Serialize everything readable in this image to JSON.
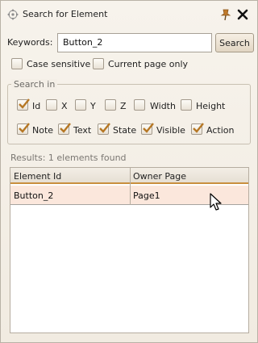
{
  "window": {
    "title": "Search for Element",
    "icons": {
      "move": "move-icon",
      "pin": "pin-icon",
      "close": "close-icon"
    }
  },
  "search": {
    "keywords_label": "Keywords:",
    "keywords_value": "Button_2",
    "button_label": "Search",
    "case_sensitive": {
      "label": "Case sensitive",
      "checked": false
    },
    "current_page_only": {
      "label": "Current page only",
      "checked": false
    }
  },
  "search_in": {
    "legend": "Search in",
    "options": [
      {
        "label": "Id",
        "checked": true
      },
      {
        "label": "X",
        "checked": false
      },
      {
        "label": "Y",
        "checked": false
      },
      {
        "label": "Z",
        "checked": false
      },
      {
        "label": "Width",
        "checked": false
      },
      {
        "label": "Height",
        "checked": false
      },
      {
        "label": "Note",
        "checked": true
      },
      {
        "label": "Text",
        "checked": true
      },
      {
        "label": "State",
        "checked": true
      },
      {
        "label": "Visible",
        "checked": true
      },
      {
        "label": "Action",
        "checked": true
      }
    ]
  },
  "results": {
    "summary": "Results: 1 elements found",
    "columns": [
      "Element Id",
      "Owner Page"
    ],
    "rows": [
      {
        "element_id": "Button_2",
        "owner_page": "Page1"
      }
    ]
  },
  "colors": {
    "accent": "#c98f3e",
    "check": "#b67724",
    "selected_row": "#fbe7dc"
  }
}
